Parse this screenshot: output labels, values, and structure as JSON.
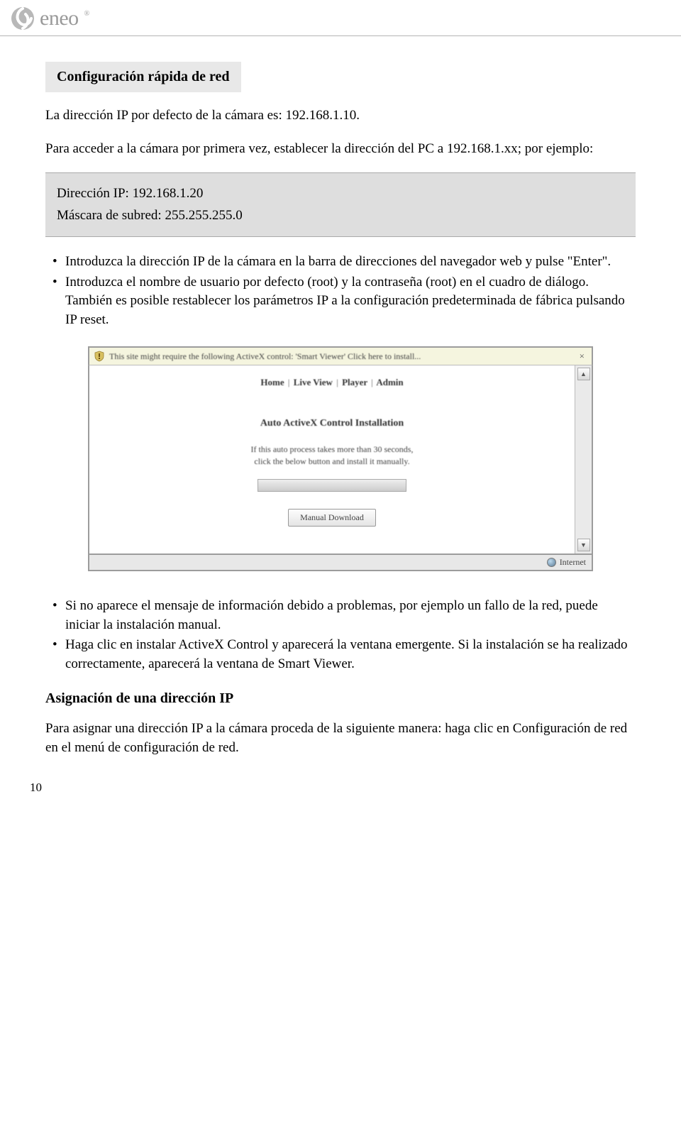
{
  "logo": {
    "brand": "eneo"
  },
  "section_heading": "Configuración rápida de red",
  "intro1": "La dirección IP por defecto de la cámara es: 192.168.1.10.",
  "intro2": "Para acceder a la cámara por primera vez, establecer la dirección del PC a 192.168.1.xx; por ejemplo:",
  "infobox": {
    "ip_line": "Dirección IP: 192.168.1.20",
    "mask_line": "Máscara de subred: 255.255.255.0"
  },
  "bullets1": [
    "Introduzca la dirección IP de la cámara en la barra de direcciones del navegador web y pulse \"Enter\".",
    "Introduzca el nombre de usuario por defecto (root) y la contraseña (root) en el cuadro de diálogo. También es posible restablecer los parámetros IP a la configuración predeterminada de fábrica pulsando IP reset."
  ],
  "screenshot": {
    "activex_msg": "This site might require the following ActiveX control: 'Smart Viewer' Click here to install...",
    "nav": [
      "Home",
      "Live View",
      "Player",
      "Admin"
    ],
    "install_title": "Auto ActiveX Control Installation",
    "install_line1": "If this auto process takes more than 30 seconds,",
    "install_line2": "click the below button and install it manually.",
    "button": "Manual Download",
    "status": "Internet"
  },
  "bullets2": [
    "Si no aparece el mensaje de información debido a problemas, por ejemplo un fallo de la red, puede iniciar la instalación manual.",
    "Haga clic en instalar ActiveX Control y aparecerá la ventana emergente. Si la instalación se ha realizado correctamente, aparecerá la ventana de Smart Viewer."
  ],
  "subheading": "Asignación de una dirección IP",
  "final_para": "Para asignar una dirección IP a la cámara proceda de la siguiente manera: haga clic en Configuración de red en el menú de configuración de red.",
  "page_number": "10"
}
